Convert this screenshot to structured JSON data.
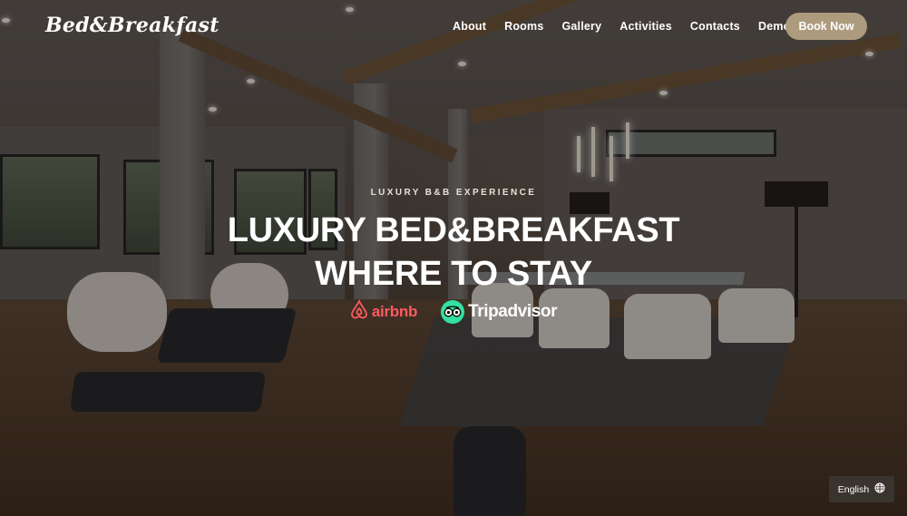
{
  "header": {
    "logo": "Bed&Breakfast",
    "nav": [
      "About",
      "Rooms",
      "Gallery",
      "Activities",
      "Contacts",
      "Demos"
    ],
    "cta": "Book Now"
  },
  "hero": {
    "eyebrow": "LUXURY B&B EXPERIENCE",
    "headline_line1": "LUXURY BED&BREAKFAST",
    "headline_line2": "WHERE TO STAY",
    "brands": {
      "airbnb": "airbnb",
      "tripadvisor": "Tripadvisor"
    }
  },
  "language": {
    "label": "English",
    "icon": "globe-icon"
  },
  "colors": {
    "cta_bg": "#ad9b7d",
    "airbnb": "#ff5a5f",
    "tripadvisor": "#34e0a1"
  }
}
